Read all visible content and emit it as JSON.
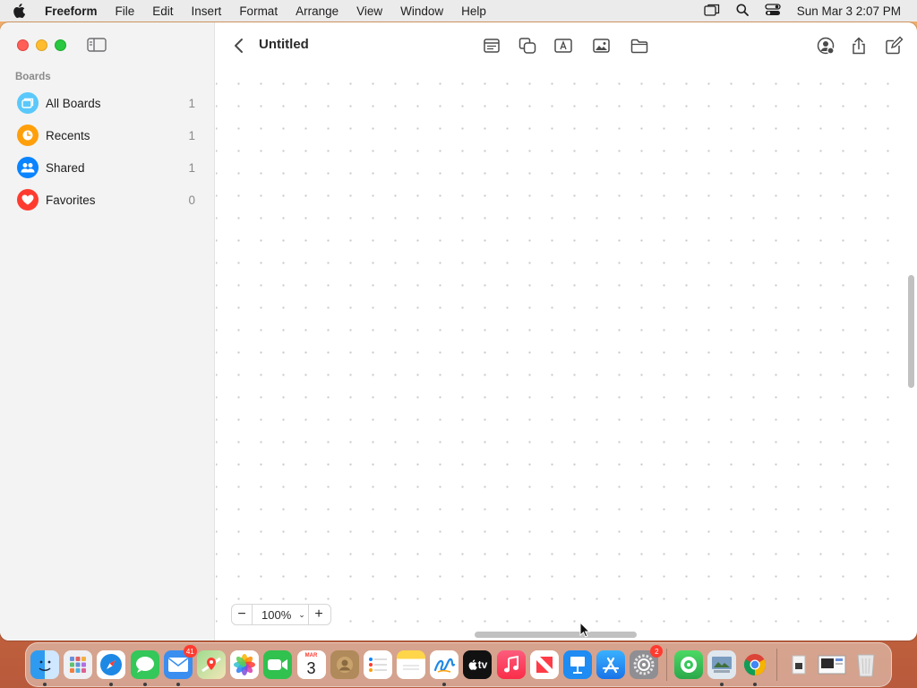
{
  "menubar": {
    "app_name": "Freeform",
    "items": [
      "File",
      "Edit",
      "Insert",
      "Format",
      "Arrange",
      "View",
      "Window",
      "Help"
    ],
    "clock": "Sun Mar 3  2:07 PM",
    "status_icons": [
      "screen-mirroring-icon",
      "spotlight-search-icon",
      "control-center-icon"
    ]
  },
  "sidebar": {
    "section_label": "Boards",
    "items": [
      {
        "label": "All Boards",
        "count": "1",
        "icon": "all-boards-icon",
        "color": "#5ac8fa"
      },
      {
        "label": "Recents",
        "count": "1",
        "icon": "clock-icon",
        "color": "#ff9f0a"
      },
      {
        "label": "Shared",
        "count": "1",
        "icon": "people-icon",
        "color": "#0a84ff"
      },
      {
        "label": "Favorites",
        "count": "0",
        "icon": "heart-icon",
        "color": "#ff3b30"
      }
    ]
  },
  "board": {
    "title": "Untitled",
    "toolbar_icons": [
      "sticky-note-icon",
      "shapes-icon",
      "text-box-icon",
      "media-icon",
      "file-icon",
      "collaborate-icon",
      "share-icon",
      "new-board-icon"
    ]
  },
  "zoom": {
    "value": "100%",
    "minus": "−",
    "plus": "+",
    "dropdown": "⌄"
  },
  "dock": {
    "apps": [
      {
        "name": "finder",
        "color": "#2f9bf0",
        "running": true
      },
      {
        "name": "launchpad",
        "color": "#9aa0ac",
        "running": false
      },
      {
        "name": "safari",
        "color": "#1e88e5",
        "running": true
      },
      {
        "name": "messages",
        "color": "#34c759",
        "running": true
      },
      {
        "name": "mail",
        "color": "#3a8ef0",
        "running": true,
        "badge": "41"
      },
      {
        "name": "maps",
        "color": "#4cae5b",
        "running": false
      },
      {
        "name": "photos",
        "color": "#f5f5f5",
        "running": false
      },
      {
        "name": "facetime",
        "color": "#30c14f",
        "running": false
      },
      {
        "name": "calendar",
        "color": "#ffffff",
        "running": false,
        "month": "MAR",
        "day": "3"
      },
      {
        "name": "contacts",
        "color": "#b08a5a",
        "running": false
      },
      {
        "name": "reminders",
        "color": "#ffffff",
        "running": false
      },
      {
        "name": "notes",
        "color": "#ffd54a",
        "running": false
      },
      {
        "name": "freeform",
        "color": "#ffffff",
        "running": true
      },
      {
        "name": "tv",
        "color": "#111111",
        "running": false,
        "label": "tv"
      },
      {
        "name": "music",
        "color": "#fa3c4c",
        "running": false
      },
      {
        "name": "news",
        "color": "#ff3b47",
        "running": false
      },
      {
        "name": "keynote",
        "color": "#1e8cf2",
        "running": false
      },
      {
        "name": "app-store",
        "color": "#1e8cf2",
        "running": false
      },
      {
        "name": "system-settings",
        "color": "#8e8e93",
        "running": false,
        "badge": "2"
      }
    ],
    "apps_right": [
      {
        "name": "finder-like",
        "color": "#3ab06a",
        "running": false
      },
      {
        "name": "preview",
        "color": "#7a9cc0",
        "running": true
      },
      {
        "name": "chrome",
        "color": "#ffffff",
        "running": true
      }
    ],
    "apps_folders": [
      {
        "name": "downloads-stack",
        "color": "#e8e8e8"
      },
      {
        "name": "screenshots-stack",
        "color": "#f0f0f0"
      },
      {
        "name": "trash",
        "color": "#d8d8d8"
      }
    ]
  }
}
